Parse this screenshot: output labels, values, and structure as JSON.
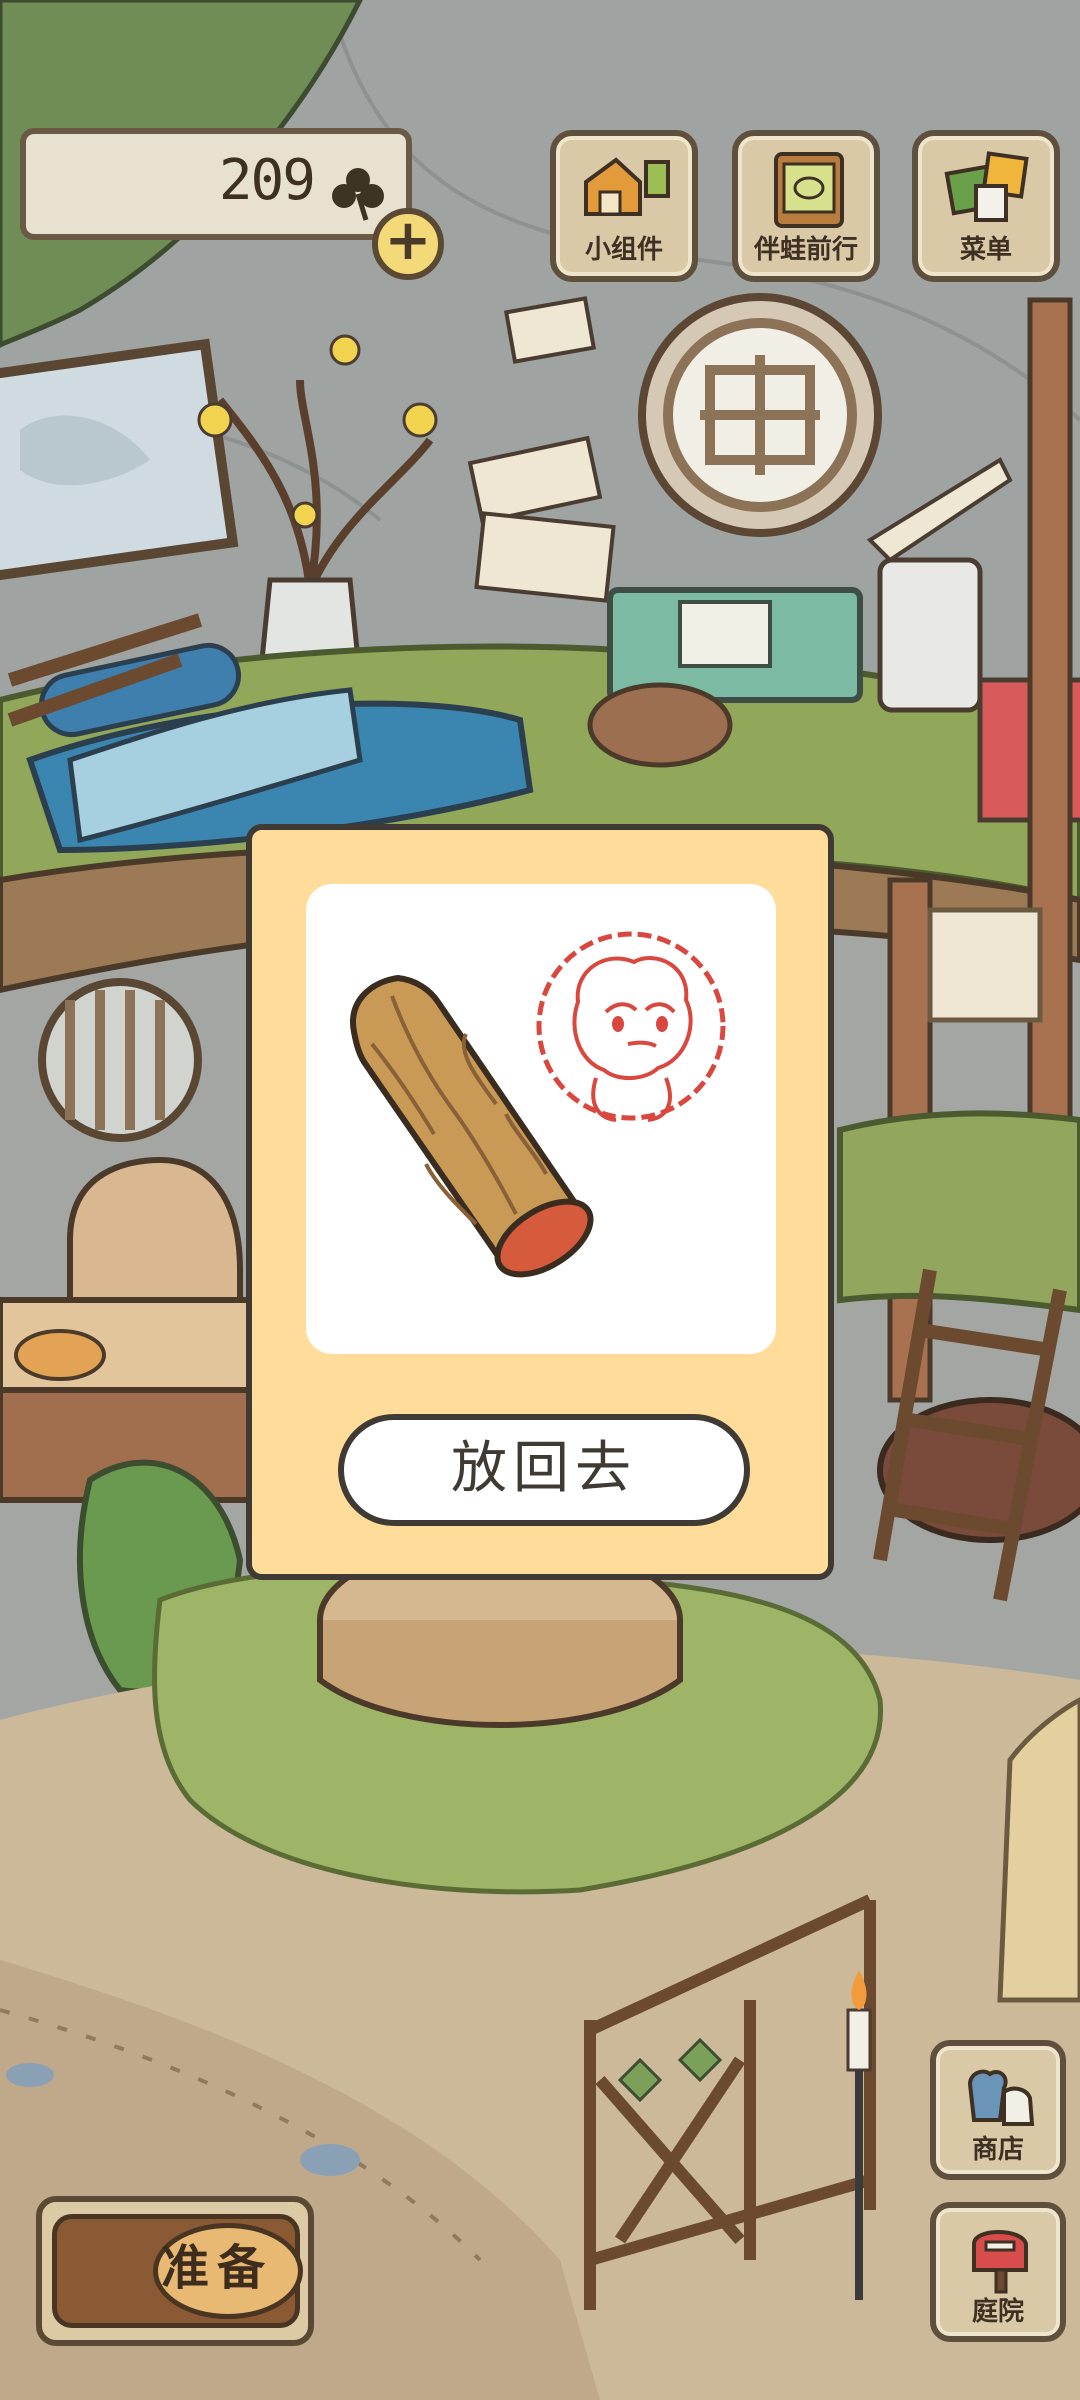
{
  "currency": {
    "clover_count": "209",
    "icon": "clover-icon",
    "add_icon": "plus-icon"
  },
  "top_menu": [
    {
      "label": "小组件",
      "icon": "widget-icon"
    },
    {
      "label": "伴蛙前行",
      "icon": "frog-journey-icon"
    },
    {
      "label": "菜单",
      "icon": "menu-cards-icon"
    }
  ],
  "side_menu": [
    {
      "label": "商店",
      "icon": "shop-bags-icon"
    },
    {
      "label": "庭院",
      "icon": "yard-mailbox-icon"
    }
  ],
  "ready_button": {
    "label": "准备"
  },
  "item_modal": {
    "item_icon": "wood-log-icon",
    "stamp_icon": "frog-stamp-icon",
    "put_back_label": "放回去"
  },
  "colors": {
    "modal_bg": "#ffdc9a",
    "outline": "#3f3a34",
    "stamp_red": "#d9473f",
    "wood": "#c89a56"
  }
}
